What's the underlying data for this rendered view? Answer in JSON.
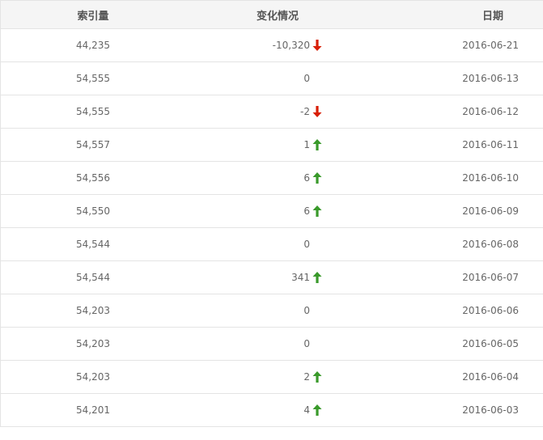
{
  "header": {
    "index_label": "索引量",
    "change_label": "变化情况",
    "date_label": "日期"
  },
  "colors": {
    "down": "#d81e06",
    "up": "#3a9a2b",
    "border": "#e4e4e4",
    "header_bg": "#f5f5f5",
    "text": "#666666"
  },
  "rows": [
    {
      "index": "44,235",
      "change": "-10,320",
      "direction": "down",
      "date": "2016-06-21"
    },
    {
      "index": "54,555",
      "change": "0",
      "direction": "none",
      "date": "2016-06-13"
    },
    {
      "index": "54,555",
      "change": "-2",
      "direction": "down",
      "date": "2016-06-12"
    },
    {
      "index": "54,557",
      "change": "1",
      "direction": "up",
      "date": "2016-06-11"
    },
    {
      "index": "54,556",
      "change": "6",
      "direction": "up",
      "date": "2016-06-10"
    },
    {
      "index": "54,550",
      "change": "6",
      "direction": "up",
      "date": "2016-06-09"
    },
    {
      "index": "54,544",
      "change": "0",
      "direction": "none",
      "date": "2016-06-08"
    },
    {
      "index": "54,544",
      "change": "341",
      "direction": "up",
      "date": "2016-06-07"
    },
    {
      "index": "54,203",
      "change": "0",
      "direction": "none",
      "date": "2016-06-06"
    },
    {
      "index": "54,203",
      "change": "0",
      "direction": "none",
      "date": "2016-06-05"
    },
    {
      "index": "54,203",
      "change": "2",
      "direction": "up",
      "date": "2016-06-04"
    },
    {
      "index": "54,201",
      "change": "4",
      "direction": "up",
      "date": "2016-06-03"
    }
  ]
}
